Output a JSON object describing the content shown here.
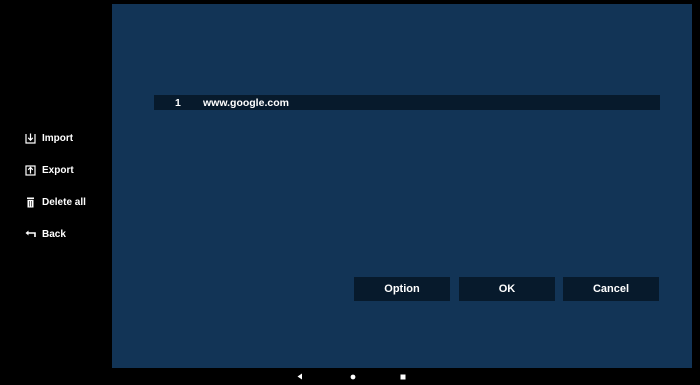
{
  "sidebar": {
    "items": [
      {
        "label": "Import",
        "icon": "import-icon"
      },
      {
        "label": "Export",
        "icon": "export-icon"
      },
      {
        "label": "Delete all",
        "icon": "trash-icon"
      },
      {
        "label": "Back",
        "icon": "back-arrow-icon"
      }
    ]
  },
  "url_list": {
    "rows": [
      {
        "index": "1",
        "url": "www.google.com"
      }
    ]
  },
  "buttons": {
    "option_label": "Option",
    "ok_label": "OK",
    "cancel_label": "Cancel"
  },
  "navbar": {
    "buttons": [
      "back-triangle-icon",
      "home-circle-icon",
      "recents-square-icon"
    ]
  },
  "colors": {
    "panel_background": "#123456",
    "control_background": "#071a2c",
    "sidebar_background": "#000000",
    "text": "#ffffff"
  }
}
